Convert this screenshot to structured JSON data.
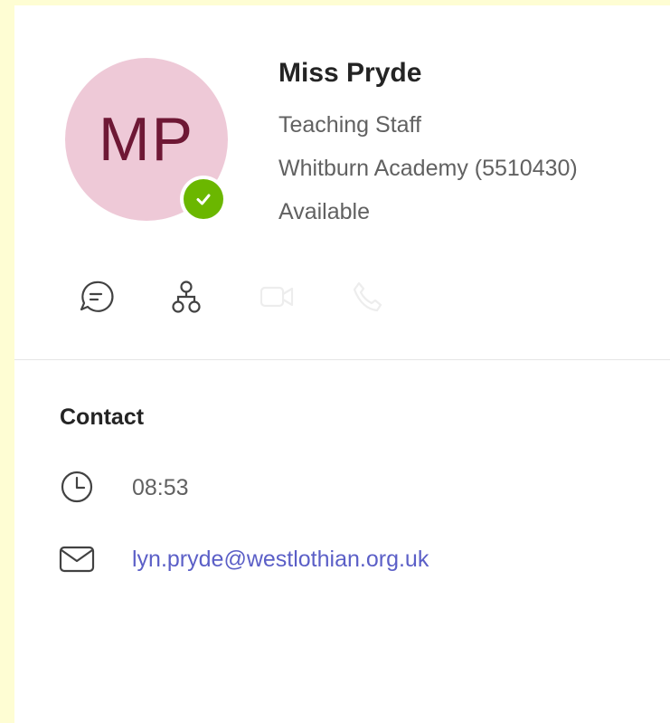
{
  "profile": {
    "initials": "MP",
    "name": "Miss Pryde",
    "role": "Teaching Staff",
    "organization": "Whitburn Academy (5510430)",
    "presence": "Available"
  },
  "actions": [
    {
      "name": "chat",
      "icon": "chat-icon"
    },
    {
      "name": "org-chart",
      "icon": "org-chart-icon"
    },
    {
      "name": "video-call",
      "icon": "video-icon"
    },
    {
      "name": "audio-call",
      "icon": "phone-icon"
    }
  ],
  "contact": {
    "title": "Contact",
    "local_time": "08:53",
    "email": "lyn.pryde@westlothian.org.uk"
  },
  "colors": {
    "avatar_bg": "#eec9d7",
    "avatar_text": "#6e1835",
    "presence_available": "#6bb700",
    "link": "#5b5fc7",
    "page_bg": "#fefdd3"
  }
}
